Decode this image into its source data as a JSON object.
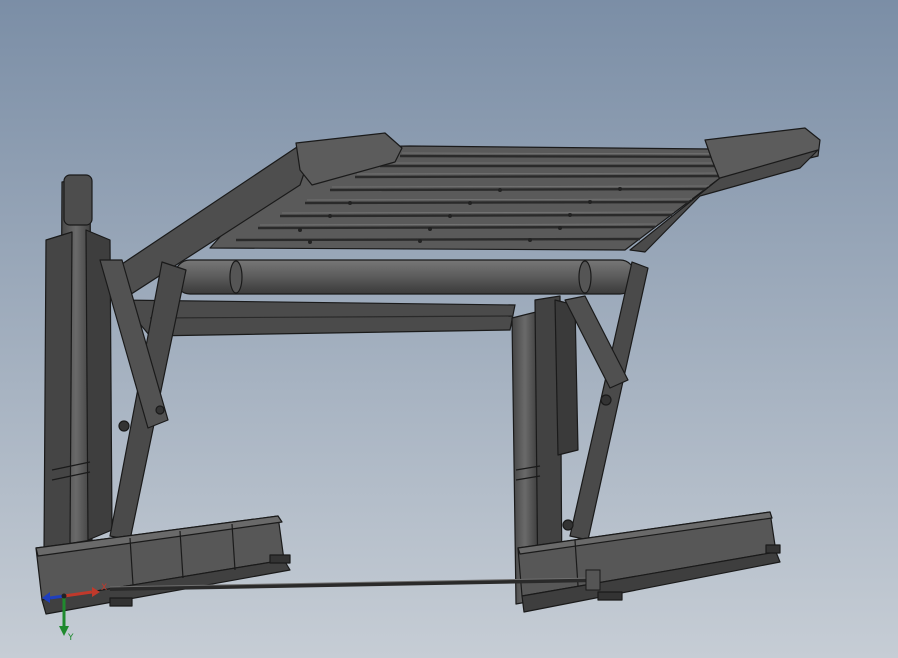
{
  "viewport": {
    "background_top": "#7b8ea6",
    "background_bottom": "#c6cdd5",
    "model_fill": "#5d5d5d",
    "model_dark": "#3f3f3f",
    "model_edge": "#1a1a1a"
  },
  "triad": {
    "x_label": "X",
    "y_label": "Y",
    "x_color": "#c0392b",
    "y_color": "#1f8a2e",
    "z_color": "#1f3fbf"
  }
}
